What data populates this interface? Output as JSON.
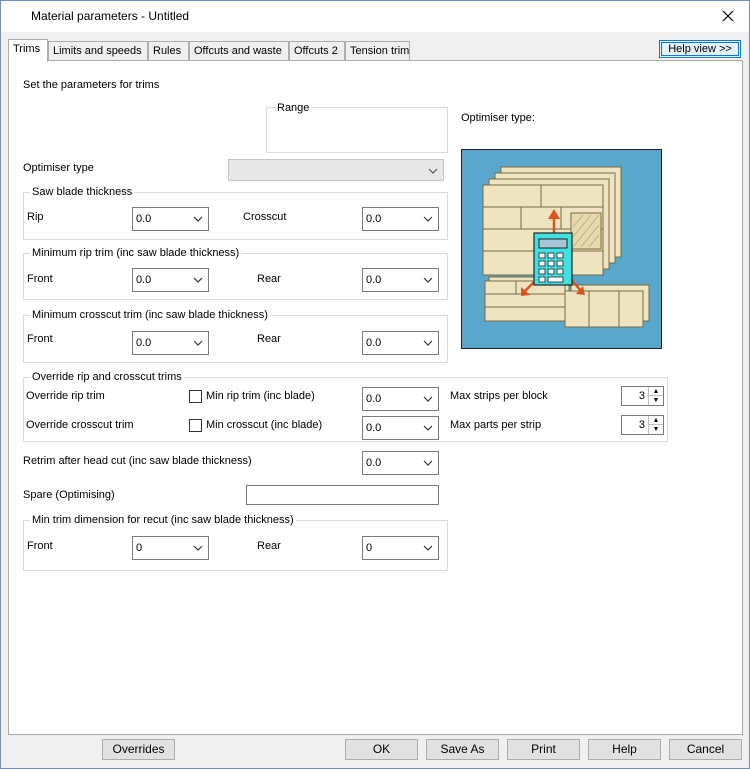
{
  "window": {
    "title": "Material parameters - Untitled"
  },
  "tabs": [
    "Trims",
    "Limits and speeds",
    "Rules",
    "Offcuts and waste",
    "Offcuts 2",
    "Tension trim"
  ],
  "help_view_label": "Help view >>",
  "panel": {
    "heading": "Set the parameters for trims",
    "range_label": "Range",
    "optimiser_type_caption": "Optimiser type:",
    "optimiser_type_label": "Optimiser type",
    "optimiser_type_value": "",
    "saw_blade": {
      "title": "Saw blade thickness",
      "rip_label": "Rip",
      "rip_value": "0.0",
      "crosscut_label": "Crosscut",
      "crosscut_value": "0.0"
    },
    "min_rip_trim": {
      "title": "Minimum rip trim (inc saw blade thickness)",
      "front_label": "Front",
      "front_value": "0.0",
      "rear_label": "Rear",
      "rear_value": "0.0"
    },
    "min_crosscut_trim": {
      "title": "Minimum crosscut trim (inc saw blade thickness)",
      "front_label": "Front",
      "front_value": "0.0",
      "rear_label": "Rear",
      "rear_value": "0.0"
    },
    "override": {
      "title": "Override rip and crosscut trims",
      "rip_label": "Override rip trim",
      "min_rip_label": "Min rip trim (inc blade)",
      "min_rip_value": "0.0",
      "crosscut_label": "Override crosscut trim",
      "min_crosscut_label": "Min crosscut (inc blade)",
      "min_crosscut_value": "0.0",
      "max_strips_label": "Max strips per block",
      "max_strips_value": "3",
      "max_parts_label": "Max parts per strip",
      "max_parts_value": "3"
    },
    "retrim_label": "Retrim after head cut (inc saw blade thickness)",
    "retrim_value": "0.0",
    "spare_label": "Spare (Optimising)",
    "spare_value": "",
    "min_trim_recut": {
      "title": "Min trim dimension for recut (inc saw blade thickness)",
      "front_label": "Front",
      "front_value": "0",
      "rear_label": "Rear",
      "rear_value": "0"
    }
  },
  "buttons": {
    "overrides": "Overrides",
    "ok": "OK",
    "save_as": "Save As",
    "print": "Print",
    "help": "Help",
    "cancel": "Cancel"
  },
  "icons": {
    "close": "close-icon",
    "dropdown": "chevron-down-icon",
    "illustration": "optimiser-illustration"
  },
  "colors": {
    "illustration_bg": "#5aa7cc",
    "board": "#efe4c2",
    "calculator": "#3fe2e2",
    "arrow": "#d9531e",
    "focus": "#0078d7"
  }
}
